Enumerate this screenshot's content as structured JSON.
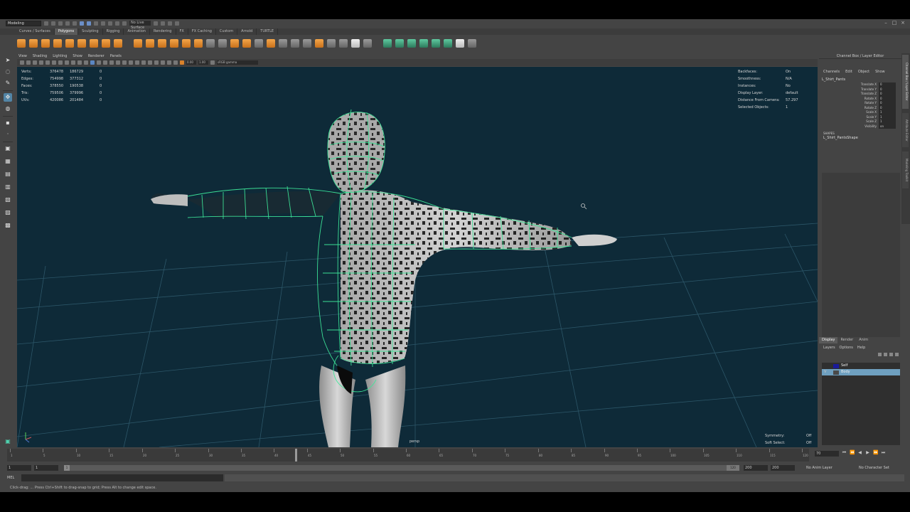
{
  "app": {
    "mode": "Modeling",
    "live_surface": "No Live Surface",
    "colors": {
      "viewport_bg": "#0e2a38",
      "wire": "#3ee89a",
      "accent": "#5285a6",
      "selected_layer": "#6fa0c0"
    }
  },
  "shelf": {
    "tabs": [
      "Curves / Surfaces",
      "Polygons",
      "Sculpting",
      "Rigging",
      "Animation",
      "Rendering",
      "FX",
      "FX Caching",
      "Custom",
      "Arnold",
      "TURTLE"
    ],
    "active_tab": "Polygons"
  },
  "panel": {
    "menu": [
      "View",
      "Shading",
      "Lighting",
      "Show",
      "Renderer",
      "Panels"
    ],
    "fields": {
      "near": "0.00",
      "far": "1.00",
      "color_space": "sRGB gamma"
    }
  },
  "hud": {
    "poly_counts": [
      {
        "label": "Verts:",
        "a": "376478",
        "b": "186729",
        "c": "0"
      },
      {
        "label": "Edges:",
        "a": "754998",
        "b": "377312",
        "c": "0"
      },
      {
        "label": "Faces:",
        "a": "378550",
        "b": "190538",
        "c": "0"
      },
      {
        "label": "Tris:",
        "a": "759506",
        "b": "379996",
        "c": "0"
      },
      {
        "label": "UVs:",
        "a": "420086",
        "b": "201484",
        "c": "0"
      }
    ],
    "stats": [
      {
        "label": "Backfaces:",
        "value": "On"
      },
      {
        "label": "Smoothness:",
        "value": "N/A"
      },
      {
        "label": "Instances:",
        "value": "No"
      },
      {
        "label": "Display Layer:",
        "value": "default"
      },
      {
        "label": "Distance From Camera:",
        "value": "57.297"
      },
      {
        "label": "Selected Objects:",
        "value": "1"
      }
    ],
    "symmetry": {
      "label": "Symmetry:",
      "value": "Off"
    },
    "soft_select": {
      "label": "Soft Select:",
      "value": "Off"
    },
    "camera": "persp"
  },
  "channel_box": {
    "title": "Channel Box / Layer Editor",
    "menu": [
      "Channels",
      "Edit",
      "Object",
      "Show"
    ],
    "object": "L_Shirt_Pants",
    "attributes": [
      {
        "name": "Translate X",
        "value": "0"
      },
      {
        "name": "Translate Y",
        "value": "0"
      },
      {
        "name": "Translate Z",
        "value": "0"
      },
      {
        "name": "Rotate X",
        "value": "0"
      },
      {
        "name": "Rotate Y",
        "value": "0"
      },
      {
        "name": "Rotate Z",
        "value": "0"
      },
      {
        "name": "Scale X",
        "value": "1"
      },
      {
        "name": "Scale Y",
        "value": "1"
      },
      {
        "name": "Scale Z",
        "value": "1"
      },
      {
        "name": "Visibility",
        "value": "on"
      }
    ],
    "shapes_label": "SHAPES",
    "shape_name": "L_Shirt_PantsShape"
  },
  "side_tabs": [
    "Channel Box / Layer Editor",
    "Attribute Editor",
    "Modeling Toolkit"
  ],
  "layer_editor": {
    "tabs": [
      "Display",
      "Render",
      "Anim"
    ],
    "active_tab": "Display",
    "menu": [
      "Layers",
      "Options",
      "Help"
    ],
    "layers": [
      {
        "name": "Self",
        "color": "#1a1a9a",
        "flag": "",
        "selected": false
      },
      {
        "name": "Body",
        "color": "#4a4a4a",
        "flag": "V",
        "selected": true
      }
    ]
  },
  "timeline": {
    "ticks": [
      "1",
      "5",
      "10",
      "15",
      "20",
      "25",
      "30",
      "35",
      "40",
      "45",
      "50",
      "55",
      "60",
      "65",
      "70",
      "75",
      "80",
      "85",
      "90",
      "95",
      "100",
      "105",
      "110",
      "115",
      "120"
    ],
    "current_frame": "70",
    "current_frame_field": "70"
  },
  "range": {
    "start": "1",
    "playback_start": "1",
    "handle_start": "1",
    "handle_end": "120",
    "playback_end": "200",
    "end": "200",
    "anim_layer": "No Anim Layer",
    "char_set": "No Character Set"
  },
  "cmdline": {
    "lang": "MEL"
  },
  "helpline": {
    "text": "Click-drag: ... Press Ctrl+Shift to drag-snap to grid; Press Alt to change edit space."
  }
}
